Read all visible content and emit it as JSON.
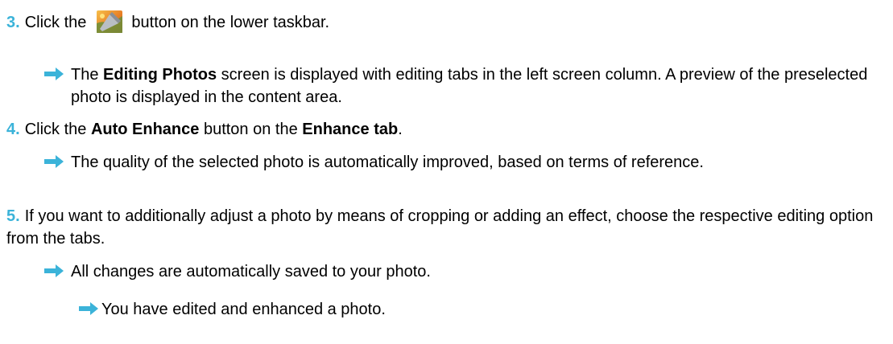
{
  "colors": {
    "step_number": "#3bb3d9",
    "arrow": "#3bb3d9",
    "text": "#000000"
  },
  "steps": [
    {
      "number": "3.",
      "parts": [
        "Click the",
        "button on the lower taskbar."
      ],
      "icon": "photo-editing-icon",
      "result": {
        "prefix": "The ",
        "bold1": "Editing Photos",
        "rest": " screen is displayed with editing tabs in the left screen column. A preview of the preselected photo is displayed in the content area."
      }
    },
    {
      "number": "4.",
      "text_before": "Click the ",
      "bold1": "Auto Enhance",
      "text_middle": " button on the ",
      "bold2": "Enhance tab",
      "text_after": ".",
      "result": {
        "text": "The quality of the selected photo is automatically improved, based on terms of reference."
      }
    },
    {
      "number": "5.",
      "text": "If you want to additionally adjust a photo by means of cropping or adding an effect, choose the respective editing option from the tabs.",
      "result": {
        "text": "All changes are automatically saved to your photo."
      }
    }
  ],
  "final_result": "You have edited and enhanced a photo."
}
